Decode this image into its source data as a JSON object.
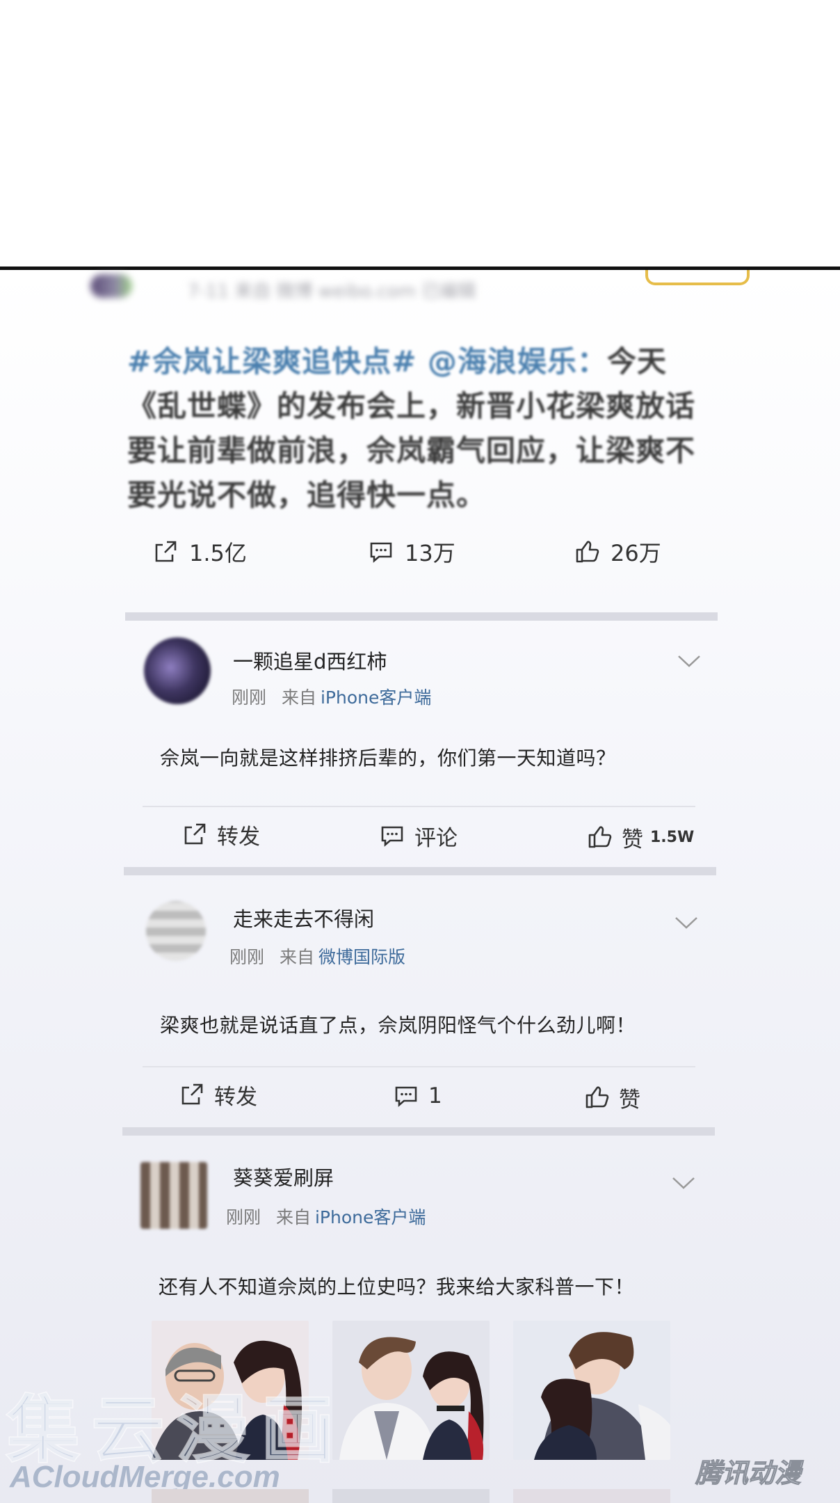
{
  "post": {
    "header_meta": "7-11  来自  微博 weibo.com  已编辑",
    "hashtag": "#佘岚让梁爽追快点#",
    "mention": "@海浪娱乐：",
    "text": "今天《乱世蝶》的发布会上，新晋小花梁爽放话要让前辈做前浪，佘岚霸气回应，让梁爽不要光说不做，追得快一点。",
    "repost_count": "1.5亿",
    "comment_count": "13万",
    "like_count": "26万"
  },
  "comments": [
    {
      "username": "一颗追星d西红柿",
      "time": "刚刚",
      "source_prefix": "来自",
      "source": "iPhone客户端",
      "text": "佘岚一向就是这样排挤后辈的，你们第一天知道吗？",
      "repost_label": "转发",
      "comment_label": "评论",
      "like_label": "赞",
      "like_count": "1.5W"
    },
    {
      "username": "走来走去不得闲",
      "time": "刚刚",
      "source_prefix": "来自",
      "source": "微博国际版",
      "text": "梁爽也就是说话直了点，佘岚阴阳怪气个什么劲儿啊！",
      "repost_label": "转发",
      "comment_label": "1",
      "like_label": "赞"
    },
    {
      "username": "葵葵爱刷屏",
      "time": "刚刚",
      "source_prefix": "来自",
      "source": "iPhone客户端",
      "text": "还有人不知道佘岚的上位史吗？我来给大家科普一下！"
    }
  ],
  "icons": [
    "repost-icon",
    "comment-icon",
    "like-icon",
    "chevron-down-icon"
  ],
  "watermarks": {
    "chinese": "集云漫画",
    "url": "ACloudMerge.com",
    "logo": "腾讯动漫"
  },
  "colors": {
    "link": "#4a7fae",
    "source": "#3d6a9a",
    "follow_border": "#e6bd4a"
  }
}
